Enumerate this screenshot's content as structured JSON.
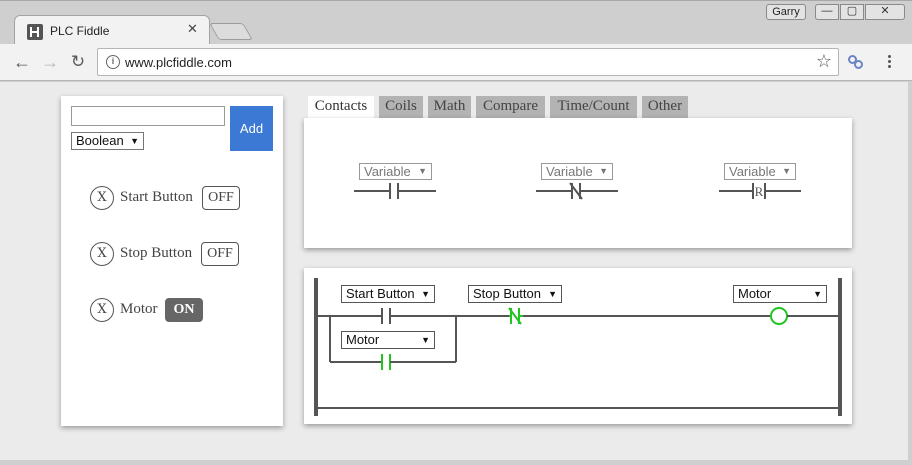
{
  "browser": {
    "tab_title": "PLC Fiddle",
    "tab_close": "✕",
    "url": "www.plcfiddle.com",
    "user_name": "Garry",
    "window_min": "—",
    "window_max": "▢",
    "window_close": "✕"
  },
  "variables_panel": {
    "name_input_value": "",
    "type_selected": "Boolean",
    "add_label": "Add",
    "delete_symbol": "X",
    "variables": [
      {
        "name": "Start Button",
        "state": "OFF"
      },
      {
        "name": "Stop Button",
        "state": "OFF"
      },
      {
        "name": "Motor",
        "state": "ON"
      }
    ]
  },
  "palette": {
    "tabs": [
      "Contacts",
      "Coils",
      "Math",
      "Compare",
      "Time/Count",
      "Other"
    ],
    "active_tab": "Contacts",
    "items": [
      {
        "select": "Variable",
        "icon": "normally-open-contact-icon"
      },
      {
        "select": "Variable",
        "icon": "normally-closed-contact-icon"
      },
      {
        "select": "Variable",
        "icon": "reset-contact-icon"
      }
    ],
    "reset_letter": "R"
  },
  "rung": {
    "contact_1": "Start Button",
    "contact_2": "Stop Button",
    "branch_contact": "Motor",
    "coil": "Motor",
    "energized_color": "#22c422",
    "rail_color": "#555555"
  },
  "icons": {
    "back": "←",
    "forward": "→",
    "reload": "↻",
    "star": "☆",
    "info": "i",
    "dropdown": "▼"
  }
}
